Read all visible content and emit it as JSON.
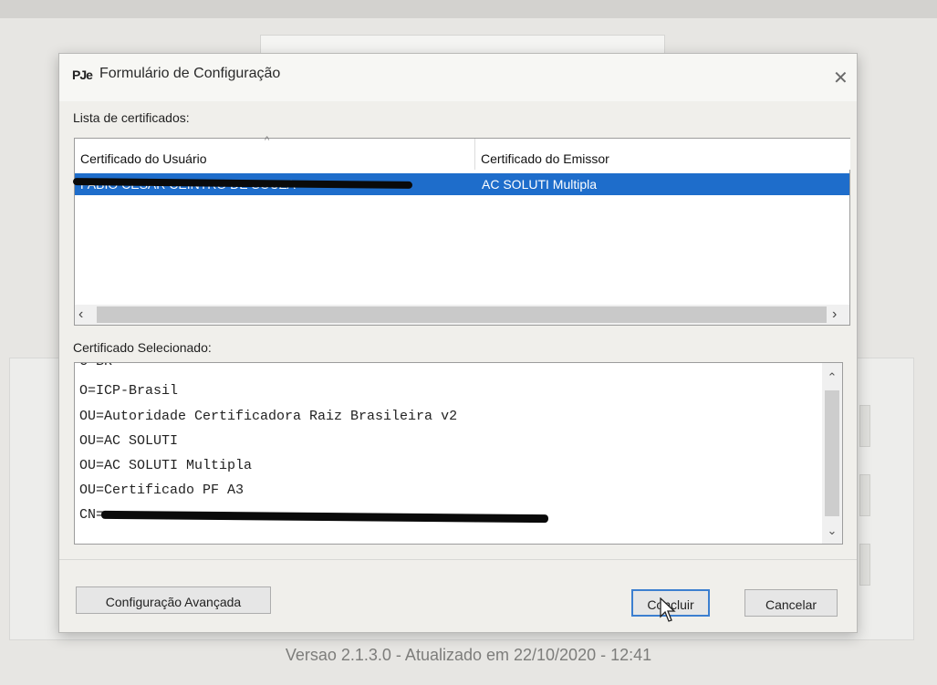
{
  "dialog": {
    "app_logo": "PJe",
    "title": "Formulário de Configuração",
    "close_icon": "close-icon"
  },
  "certificate_list": {
    "label": "Lista de certificados:",
    "columns": [
      "Certificado do Usuário",
      "Certificado do Emissor"
    ],
    "rows": [
      {
        "user": "FABIO CESAR CEINTRO DE SOUZA",
        "issuer": "AC SOLUTI Multipla",
        "selected": true
      }
    ]
  },
  "selected_certificate": {
    "label": "Certificado Selecionado:",
    "lines": [
      "C=BR",
      "O=ICP-Brasil",
      "OU=Autoridade Certificadora Raiz Brasileira v2",
      "OU=AC SOLUTI",
      "OU=AC SOLUTI Multipla",
      "OU=Certificado PF A3",
      "CN="
    ]
  },
  "buttons": {
    "advanced": "Configuração Avançada",
    "conclude": "Concluir",
    "cancel": "Cancelar"
  },
  "footer": {
    "version": "Versao 2.1.3.0 - Atualizado em 22/10/2020 - 12:41"
  },
  "colors": {
    "selection": "#1e6dcb",
    "default_button_border": "#3c7fd0"
  }
}
